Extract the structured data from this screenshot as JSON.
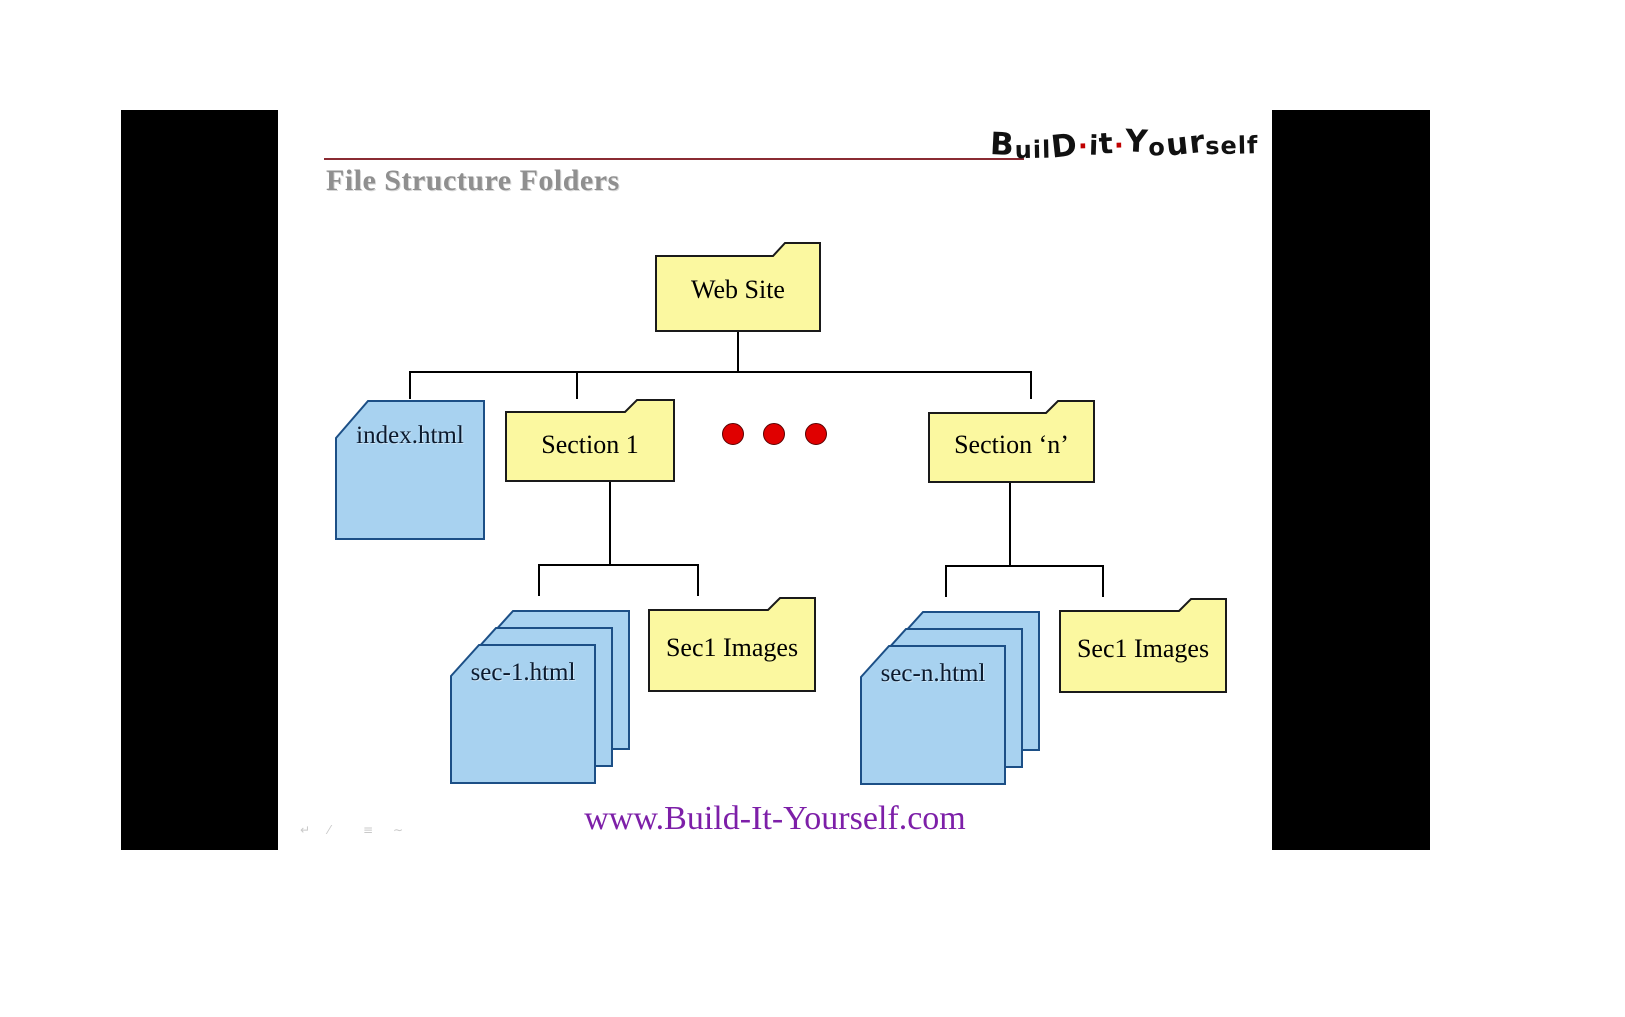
{
  "slide": {
    "title": "File Structure Folders",
    "logo": {
      "part1": "B",
      "part2": "uil",
      "part3": "D",
      "dot1": "·",
      "part4": "i",
      "part5": "t",
      "dot2": "·",
      "part6": "Y",
      "part7": "o",
      "part8": "ur",
      "part9": "self",
      "full_text": "Build·it·Yourself"
    },
    "footer_url": "www.Build-It-Yourself.com",
    "artifacts": [
      "↵",
      "⁄",
      "≡",
      "∼"
    ]
  },
  "diagram": {
    "type": "tree",
    "root": {
      "label": "Web Site",
      "kind": "folder"
    },
    "level2": [
      {
        "label": "index.html",
        "kind": "document"
      },
      {
        "label": "Section 1",
        "kind": "folder"
      },
      {
        "label": "Section ‘n’",
        "kind": "folder"
      }
    ],
    "ellipsis_dots": 3,
    "level3_left": [
      {
        "label": "sec-1.html",
        "kind": "document-stack",
        "copies": 3
      },
      {
        "label": "Sec1 Images",
        "kind": "folder"
      }
    ],
    "level3_right": [
      {
        "label": "sec-n.html",
        "kind": "document-stack",
        "copies": 3
      },
      {
        "label": "Sec1 Images",
        "kind": "folder"
      }
    ]
  },
  "colors": {
    "folder_fill": "#fbf8a0",
    "folder_stroke": "#1a1a1a",
    "document_fill": "#a8d2f0",
    "document_stroke": "#1c4f86",
    "dot_fill": "#e00000",
    "title_gray": "#8f8f8f",
    "rule_red": "#8a2b33",
    "url_purple": "#7d1fa8",
    "letterbox": "#000000"
  }
}
